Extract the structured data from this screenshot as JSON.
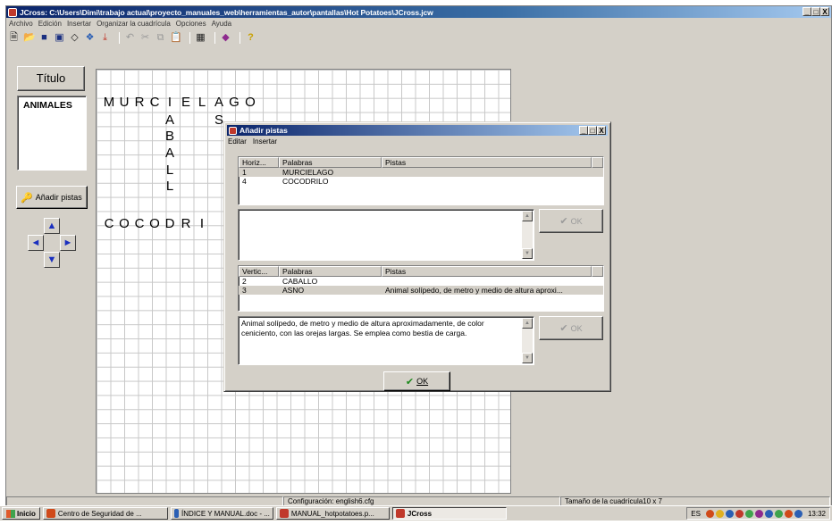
{
  "window": {
    "title": "JCross: C:\\Users\\Dimi\\trabajo actual\\proyecto_manuales_web\\herramientas_autor\\pantallas\\Hot Potatoes\\JCross.jcw",
    "controls": [
      "_",
      "□",
      "X"
    ]
  },
  "menu": [
    "Archivo",
    "Edición",
    "Insertar",
    "Organizar la cuadrícula",
    "Opciones",
    "Ayuda"
  ],
  "toolbar": {
    "icons": [
      "new-file-icon",
      "open-folder-icon",
      "save-icon",
      "save-as-icon",
      "diamond-icon",
      "html-export-icon",
      "add-icon",
      "undo-icon",
      "cut-icon",
      "copy-icon",
      "paste-icon",
      "grid-icon",
      "export-icon",
      "help-icon"
    ]
  },
  "left_panel": {
    "titulo_button": "Título",
    "title_value": "ANIMALES",
    "add_clues_button": "Añadir pistas",
    "arrows": {
      "up": "▲",
      "left": "◄",
      "right": "►",
      "down": "▼"
    }
  },
  "grid": {
    "size": "10 x 7",
    "letters": [
      {
        "row": 2,
        "col": 0,
        "ch": "M"
      },
      {
        "row": 2,
        "col": 1,
        "ch": "U"
      },
      {
        "row": 2,
        "col": 2,
        "ch": "R"
      },
      {
        "row": 2,
        "col": 3,
        "ch": "C"
      },
      {
        "row": 2,
        "col": 4,
        "ch": "I"
      },
      {
        "row": 2,
        "col": 5,
        "ch": "E"
      },
      {
        "row": 2,
        "col": 6,
        "ch": "L"
      },
      {
        "row": 2,
        "col": 7,
        "ch": "A"
      },
      {
        "row": 2,
        "col": 8,
        "ch": "G"
      },
      {
        "row": 2,
        "col": 9,
        "ch": "O"
      },
      {
        "row": 3,
        "col": 4,
        "ch": "A"
      },
      {
        "row": 3,
        "col": 7,
        "ch": "S"
      },
      {
        "row": 4,
        "col": 4,
        "ch": "B"
      },
      {
        "row": 5,
        "col": 4,
        "ch": "A"
      },
      {
        "row": 6,
        "col": 4,
        "ch": "L"
      },
      {
        "row": 7,
        "col": 4,
        "ch": "L"
      },
      {
        "row": 8,
        "col": 0,
        "ch": "C"
      },
      {
        "row": 8,
        "col": 1,
        "ch": "O"
      },
      {
        "row": 8,
        "col": 2,
        "ch": "C"
      },
      {
        "row": 8,
        "col": 3,
        "ch": "O"
      },
      {
        "row": 8,
        "col": 4,
        "ch": "D"
      },
      {
        "row": 8,
        "col": 5,
        "ch": "R"
      },
      {
        "row": 8,
        "col": 6,
        "ch": "I"
      }
    ]
  },
  "dialog": {
    "title": "Añadir pistas",
    "controls": [
      "_",
      "□",
      "X"
    ],
    "menu": [
      "Editar",
      "Insertar"
    ],
    "across": {
      "headers": [
        "Horiz...",
        "Palabras",
        "Pistas"
      ],
      "rows": [
        {
          "num": "1",
          "word": "MURCIELAGO",
          "clue": "",
          "selected": true
        },
        {
          "num": "4",
          "word": "COCODRILO",
          "clue": "",
          "selected": false
        }
      ],
      "memo": "",
      "ok_label": "OK"
    },
    "down": {
      "headers": [
        "Vertic...",
        "Palabras",
        "Pistas"
      ],
      "rows": [
        {
          "num": "2",
          "word": "CABALLO",
          "clue": "",
          "selected": false
        },
        {
          "num": "3",
          "word": "ASNO",
          "clue": "Animal solípedo, de metro y medio de altura aproxi...",
          "selected": true
        }
      ],
      "memo": "Animal solípedo, de metro y medio de altura aproximadamente, de color ceniciento, con las orejas largas. Se emplea como bestia de carga.",
      "ok_label": "OK"
    },
    "ok_label": "OK"
  },
  "statusbar": {
    "config": "Configuración: english6.cfg",
    "grid_size": "Tamaño de la cuadrícula10 x 7"
  },
  "taskbar": {
    "start": "Inicio",
    "tasks": [
      {
        "label": "Centro de Seguridad de ...",
        "color": "#d04a1a",
        "active": false
      },
      {
        "label": "ÍNDICE Y MANUAL.doc - ...",
        "color": "#2b5fb4",
        "active": false
      },
      {
        "label": "MANUAL_hotpotatoes.p...",
        "color": "#c0392b",
        "active": false
      },
      {
        "label": "JCross",
        "color": "#c0392b",
        "active": true
      }
    ],
    "lang": "ES",
    "clock": "13:32"
  }
}
